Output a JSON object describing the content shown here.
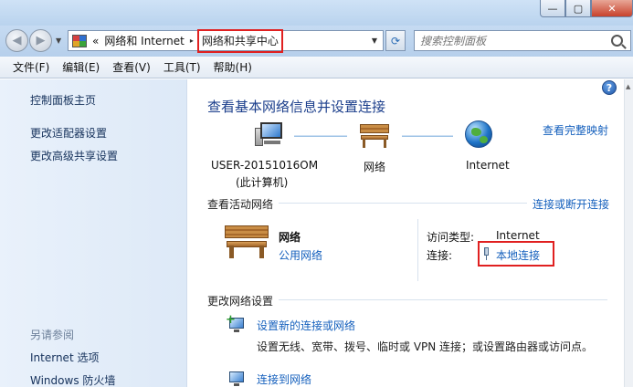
{
  "window": {
    "minimize_glyph": "—",
    "maximize_glyph": "▢",
    "close_glyph": "✕"
  },
  "address": {
    "overflow": "«",
    "segment1": "网络和 Internet",
    "separator": "▸",
    "current": "网络和共享中心"
  },
  "search": {
    "placeholder": "搜索控制面板"
  },
  "menu": {
    "file": "文件(F)",
    "edit": "编辑(E)",
    "view": "查看(V)",
    "tools": "工具(T)",
    "help": "帮助(H)"
  },
  "sidebar": {
    "home": "控制面板主页",
    "adapter": "更改适配器设置",
    "sharing": "更改高级共享设置",
    "see_also": "另请参阅",
    "internet_options": "Internet 选项",
    "firewall": "Windows 防火墙"
  },
  "main": {
    "title": "查看基本网络信息并设置连接",
    "full_map": "查看完整映射",
    "map": {
      "computer_name": "USER-20151016OM",
      "computer_sub": "(此计算机)",
      "network": "网络",
      "internet": "Internet"
    },
    "active": {
      "heading": "查看活动网络",
      "connect_link": "连接或断开连接",
      "network_name": "网络",
      "network_type": "公用网络",
      "access_label": "访问类型:",
      "access_value": "Internet",
      "connection_label": "连接:",
      "connection_value": "本地连接"
    },
    "change": {
      "heading": "更改网络设置",
      "task1_title": "设置新的连接或网络",
      "task1_desc": "设置无线、宽带、拨号、临时或 VPN 连接；或设置路由器或访问点。",
      "task2_title": "连接到网络"
    },
    "help_glyph": "?"
  },
  "colors": {
    "link": "#1560bd",
    "title": "#1c3f8c",
    "highlight": "#e02020"
  }
}
